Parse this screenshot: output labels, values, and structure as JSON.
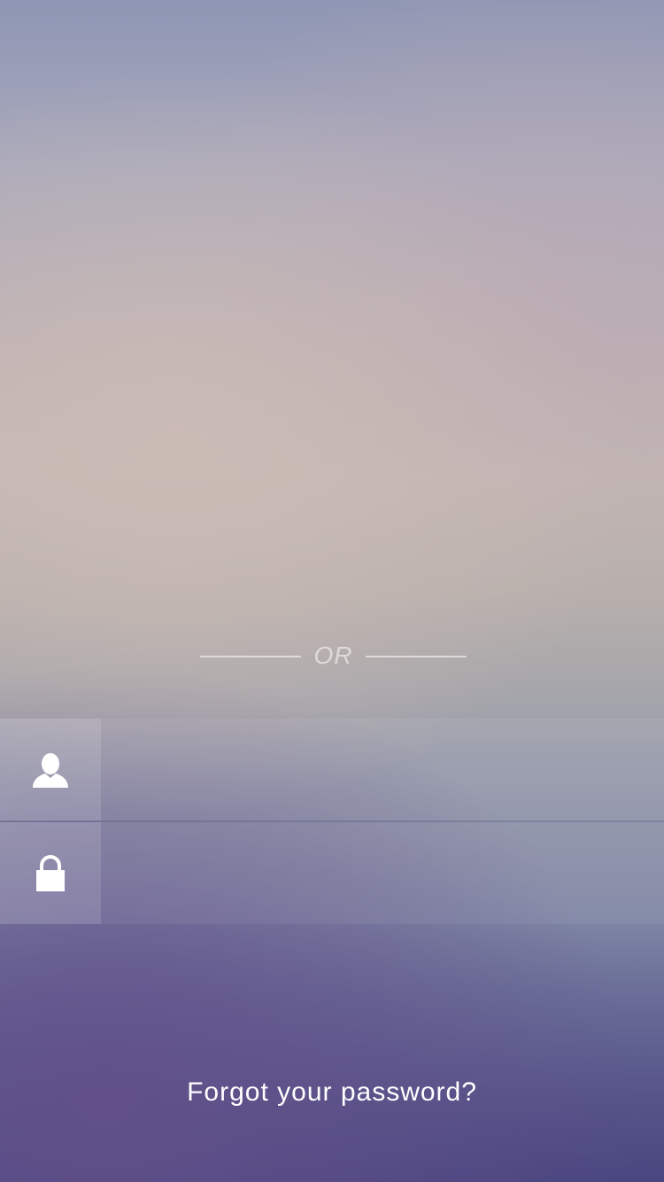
{
  "divider": {
    "label": "OR"
  },
  "login_form": {
    "username": {
      "icon": "user-icon",
      "value": "",
      "placeholder": ""
    },
    "password": {
      "icon": "lock-icon",
      "value": "",
      "placeholder": ""
    }
  },
  "forgot_password": {
    "label": "Forgot your password?"
  },
  "colors": {
    "text": "#ffffff",
    "background_top": "#8e96b4",
    "background_middle": "#c2b7b2",
    "background_bottom": "#4a4680"
  }
}
